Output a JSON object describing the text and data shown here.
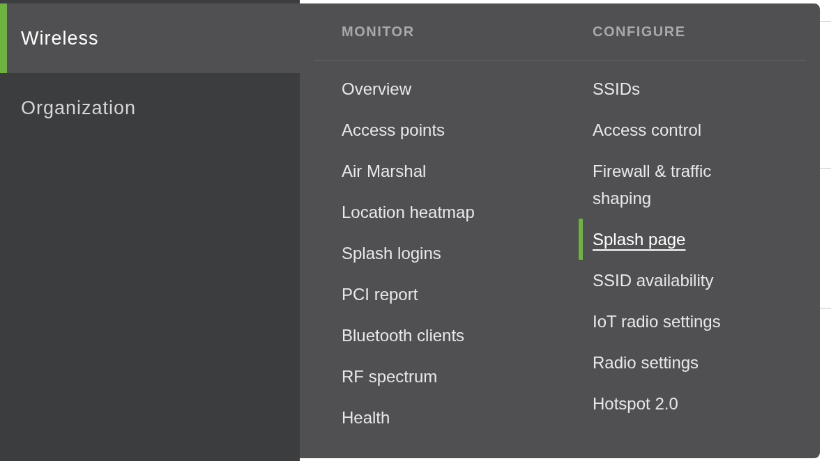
{
  "sidebar": {
    "items": [
      {
        "label": "Wireless",
        "selected": true
      },
      {
        "label": "Organization",
        "selected": false
      }
    ]
  },
  "flyout": {
    "columns": [
      {
        "title": "MONITOR",
        "items": [
          {
            "label": "Overview",
            "selected": false
          },
          {
            "label": "Access points",
            "selected": false
          },
          {
            "label": "Air Marshal",
            "selected": false
          },
          {
            "label": "Location heatmap",
            "selected": false
          },
          {
            "label": "Splash logins",
            "selected": false
          },
          {
            "label": "PCI report",
            "selected": false
          },
          {
            "label": "Bluetooth clients",
            "selected": false
          },
          {
            "label": "RF spectrum",
            "selected": false
          },
          {
            "label": "Health",
            "selected": false
          }
        ]
      },
      {
        "title": "CONFIGURE",
        "items": [
          {
            "label": "SSIDs",
            "selected": false
          },
          {
            "label": "Access control",
            "selected": false
          },
          {
            "label": "Firewall & traffic shaping",
            "selected": false
          },
          {
            "label": "Splash page",
            "selected": true
          },
          {
            "label": "SSID availability",
            "selected": false
          },
          {
            "label": "IoT radio settings",
            "selected": false
          },
          {
            "label": "Radio settings",
            "selected": false
          },
          {
            "label": "Hotspot 2.0",
            "selected": false
          }
        ]
      }
    ]
  }
}
